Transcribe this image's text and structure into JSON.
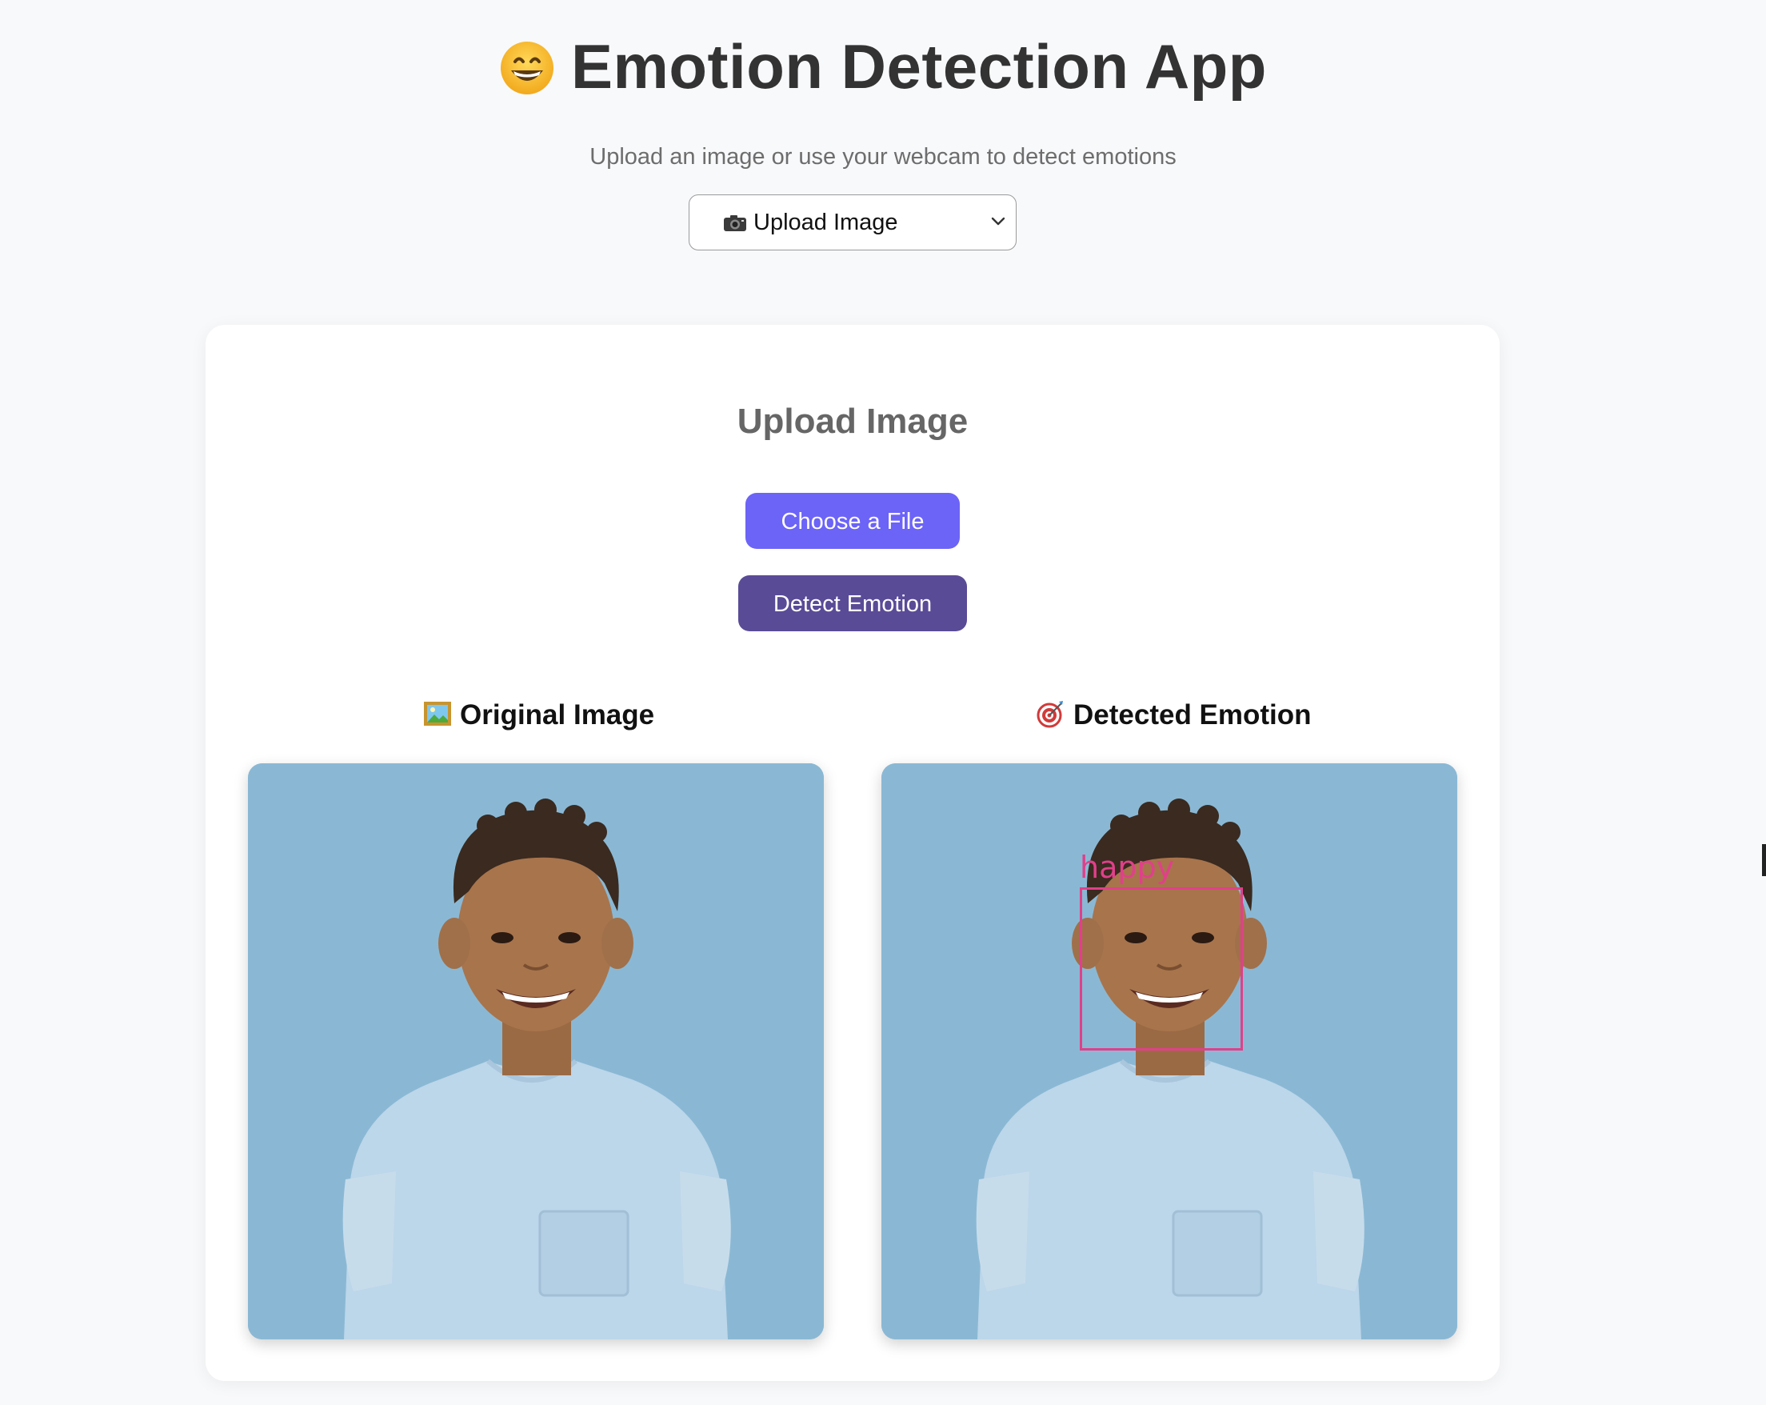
{
  "header": {
    "title": "Emotion Detection App",
    "title_icon": "grinning-face-icon",
    "subtitle": "Upload an image or use your webcam to detect emotions"
  },
  "mode_select": {
    "icon": "camera-icon",
    "selected": "Upload Image"
  },
  "card": {
    "title": "Upload Image",
    "choose_file_label": "Choose a File",
    "detect_label": "Detect Emotion",
    "original_heading": "Original Image",
    "original_icon": "framed-picture-icon",
    "detected_heading": "Detected Emotion",
    "detected_icon": "target-icon",
    "detection_label": "happy"
  },
  "colors": {
    "page_bg": "#f8f9fb",
    "choose_button": "#6c63f7",
    "detect_button": "#5a4b97",
    "detection_box": "#e0408a",
    "photo_bg": "#8ab8d4"
  }
}
